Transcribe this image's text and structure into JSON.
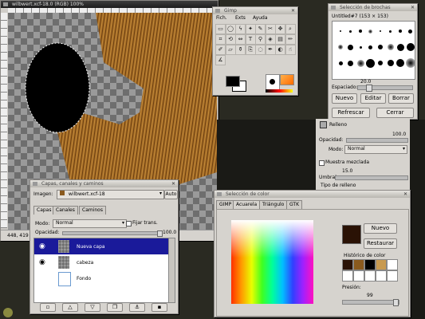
{
  "canvas_window": {
    "title": "wilbwert.xcf-18.0 (RGB) 100%",
    "status": "448, 419"
  },
  "toolbox": {
    "title": "Gimp",
    "menu": [
      "Fich.",
      "Exts",
      "Ayuda"
    ],
    "tools": [
      "rect-select",
      "ellipse-select",
      "free-select",
      "fuzzy-select",
      "bezier-select",
      "scissors",
      "move",
      "magnify",
      "crop",
      "transform",
      "flip",
      "text",
      "color-picker",
      "bucket-fill",
      "blend",
      "pencil",
      "paintbrush",
      "eraser",
      "airbrush",
      "clone",
      "convolve",
      "ink",
      "dodge",
      "smudge",
      "measure"
    ]
  },
  "brush_dialog": {
    "title": "Selección de brochas",
    "brush_name": "Untitled#7 (153 × 153)",
    "spacing_label": "Espaciado:",
    "spacing_value": "20.0",
    "btn_new": "Nuevo",
    "btn_edit": "Editar",
    "btn_delete": "Borrar",
    "btn_refresh": "Refrescar",
    "btn_close": "Cerrar"
  },
  "tool_options": {
    "tool_name": "Relleno",
    "opacity_label": "Opacidad:",
    "opacity_value": "100.0",
    "mode_label": "Modo:",
    "mode_value": "Normal",
    "sample_merged": "Muestra mezclada",
    "threshold_label": "Umbral",
    "threshold_value": "15.0",
    "fill_type_label": "Tipo de relleno"
  },
  "layers_dialog": {
    "title": "Capas, canales y caminos",
    "image_label": "Imagen:",
    "image_value": "wilbwert.xcf-18",
    "auto_label": "Auto",
    "tabs": [
      "Capas",
      "Canales",
      "Caminos"
    ],
    "mode_label": "Modo:",
    "mode_value": "Normal",
    "keep_trans": "Fijar trans.",
    "opacity_label": "Opacidad:",
    "opacity_value": "100.0",
    "layers": [
      {
        "name": "Nueva capa",
        "selected": true,
        "visible": true
      },
      {
        "name": "cabeza",
        "selected": false,
        "visible": true
      },
      {
        "name": "Fondo",
        "selected": false,
        "visible": false
      }
    ]
  },
  "color_dialog": {
    "title": "Selección de color",
    "tabs": [
      "GIMP",
      "Acuarela",
      "Triángulo",
      "GTK"
    ],
    "active_tab": "Acuarela",
    "btn_new": "Nuevo",
    "btn_restore": "Restaurar",
    "history_label": "Histórico de color",
    "pressure_label": "Presión:",
    "pressure_value": "99",
    "current_color": "#2a1205",
    "history_colors": [
      "#2a1205",
      "#8a5a1e",
      "#000000",
      "#c89a50",
      "#ffffff",
      "#ffffff",
      "#ffffff",
      "#ffffff",
      "#ffffff",
      "#ffffff"
    ]
  }
}
